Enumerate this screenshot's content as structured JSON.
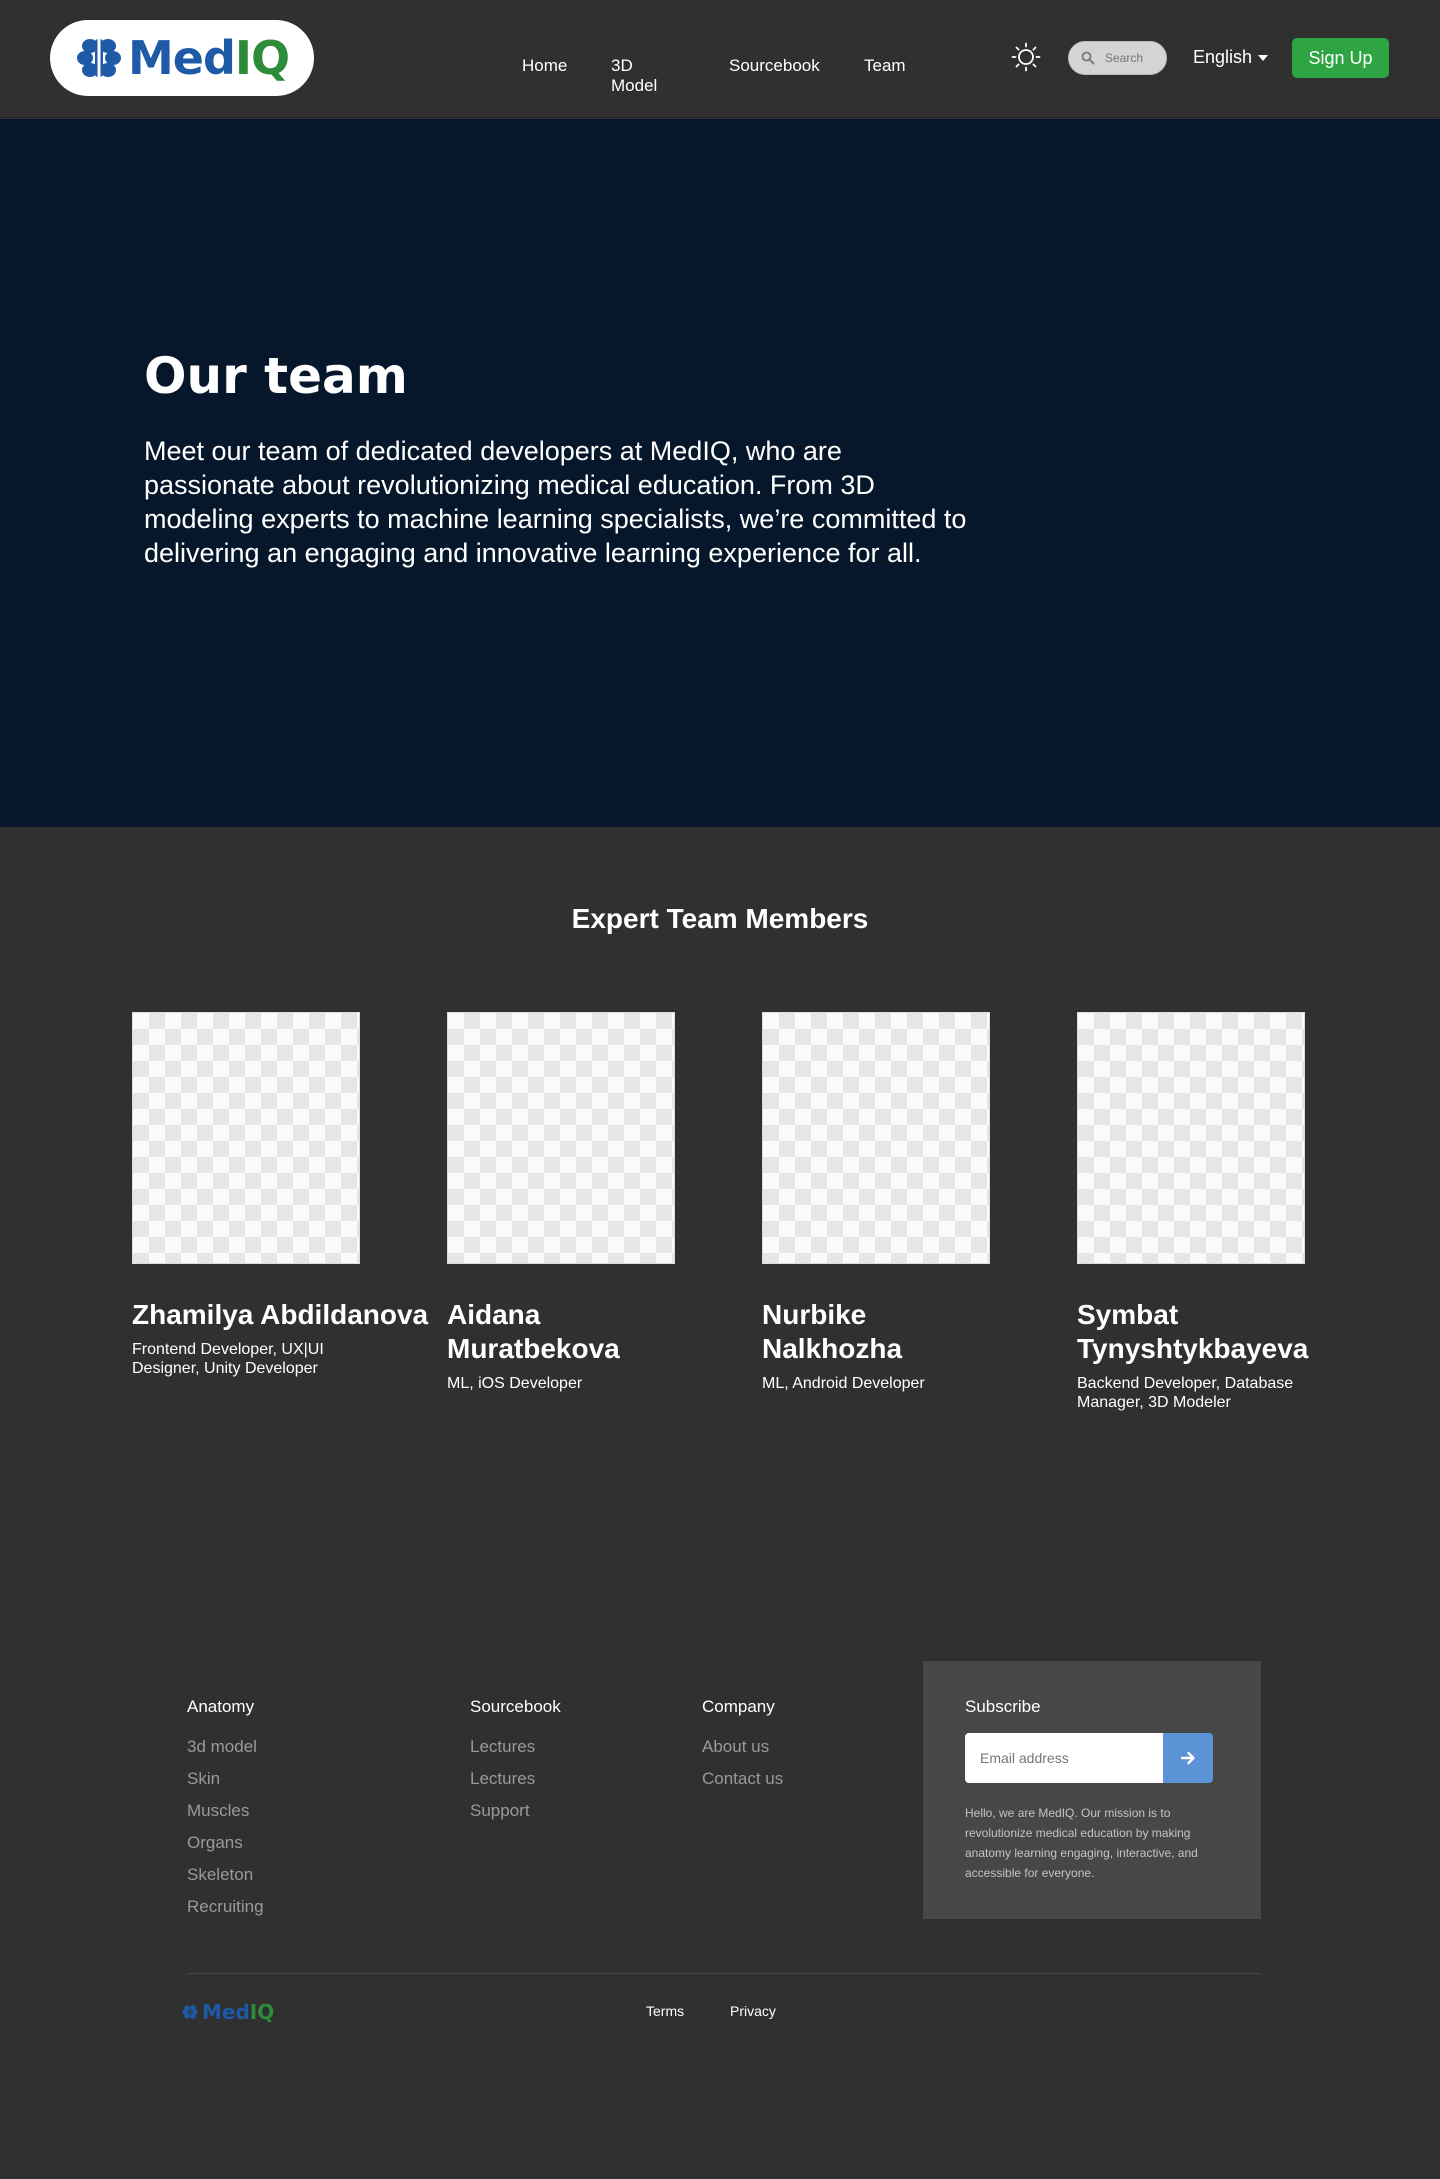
{
  "header": {
    "logo": {
      "part1": "Med",
      "part2": "IQ"
    },
    "nav": [
      "Home",
      "3D Model",
      "Sourcebook",
      "Team"
    ],
    "search_placeholder": "Search",
    "language": "English",
    "signup_label": "Sign Up",
    "theme_icon": "sun-icon"
  },
  "hero": {
    "title": "Our team",
    "text": "Meet our team of dedicated developers at MedIQ, who are passionate about revolutionizing medical education. From 3D modeling experts to machine learning specialists, we’re committed to delivering an engaging and innovative learning experience for all."
  },
  "team": {
    "title": "Expert Team Members",
    "members": [
      {
        "name": "Zhamilya Abdildanova",
        "role": "Frontend Developer, UX|UI Designer, Unity Developer"
      },
      {
        "name": "Aidana Muratbekova",
        "role": "ML, iOS Developer"
      },
      {
        "name": "Nurbike Nalkhozha",
        "role": "ML, Android Developer"
      },
      {
        "name": "Symbat Tynyshtykbayeva",
        "role": "Backend Developer, Database Manager, 3D Modeler"
      }
    ]
  },
  "footer": {
    "anatomy": {
      "title": "Anatomy",
      "links": [
        "3d model",
        "Skin",
        "Muscles",
        "Organs",
        "Skeleton",
        "Recruiting"
      ]
    },
    "sourcebook": {
      "title": "Sourcebook",
      "links": [
        "Lectures",
        "Lectures",
        "Support"
      ]
    },
    "company": {
      "title": "Company",
      "links": [
        "About us",
        "Contact us"
      ]
    },
    "subscribe": {
      "title": "Subscribe",
      "placeholder": "Email address",
      "description": "Hello, we are MedIQ. Our mission is to revolutionize medical education by making anatomy learning engaging, interactive, and accessible for everyone."
    },
    "terms": "Terms",
    "privacy": "Privacy"
  },
  "colors": {
    "brand_blue": "#1f5aa8",
    "brand_green": "#2e8b3a",
    "hero_bg": "#06172b",
    "page_bg": "#303030",
    "signup_green": "#2ea443",
    "subscribe_button": "#5b93d6"
  }
}
